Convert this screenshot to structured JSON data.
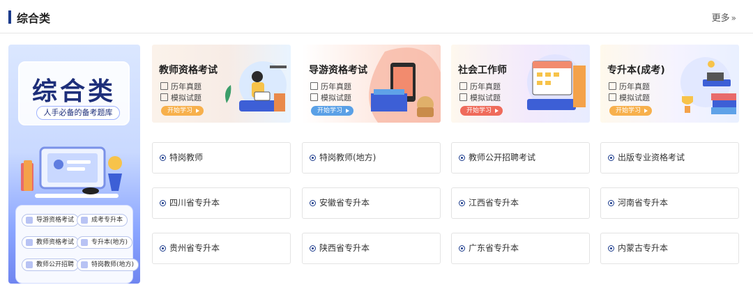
{
  "section": {
    "title": "综合类",
    "more_label": "更多",
    "more_icon": "double-chevron-right-icon"
  },
  "side_banner": {
    "title": "综合类",
    "subtitle": "人手必备的备考题库",
    "tags": [
      "导游资格考试",
      "成考专升本",
      "教师资格考试",
      "专升本(地方)",
      "教师公开招聘",
      "特岗教师(地方)"
    ]
  },
  "cards": [
    {
      "title": "教师资格考试",
      "items": [
        "历年真题",
        "模拟试题"
      ],
      "button": "开始学习"
    },
    {
      "title": "导游资格考试",
      "items": [
        "历年真题",
        "模拟试题"
      ],
      "button": "开始学习"
    },
    {
      "title": "社会工作师",
      "items": [
        "历年真题",
        "模拟试题"
      ],
      "button": "开始学习"
    },
    {
      "title": "专升本(成考)",
      "items": [
        "历年真题",
        "模拟试题"
      ],
      "button": "开始学习"
    }
  ],
  "links": [
    [
      "特岗教师",
      "特岗教师(地方)",
      "教师公开招聘考试",
      "出版专业资格考试"
    ],
    [
      "四川省专升本",
      "安徽省专升本",
      "江西省专升本",
      "河南省专升本"
    ],
    [
      "贵州省专升本",
      "陕西省专升本",
      "广东省专升本",
      "内蒙古专升本"
    ]
  ],
  "colors": {
    "accent": "#1b3b8c",
    "button_orange": "#f7b04c",
    "button_blue": "#5aa0e6",
    "button_red": "#ef6b5b"
  }
}
